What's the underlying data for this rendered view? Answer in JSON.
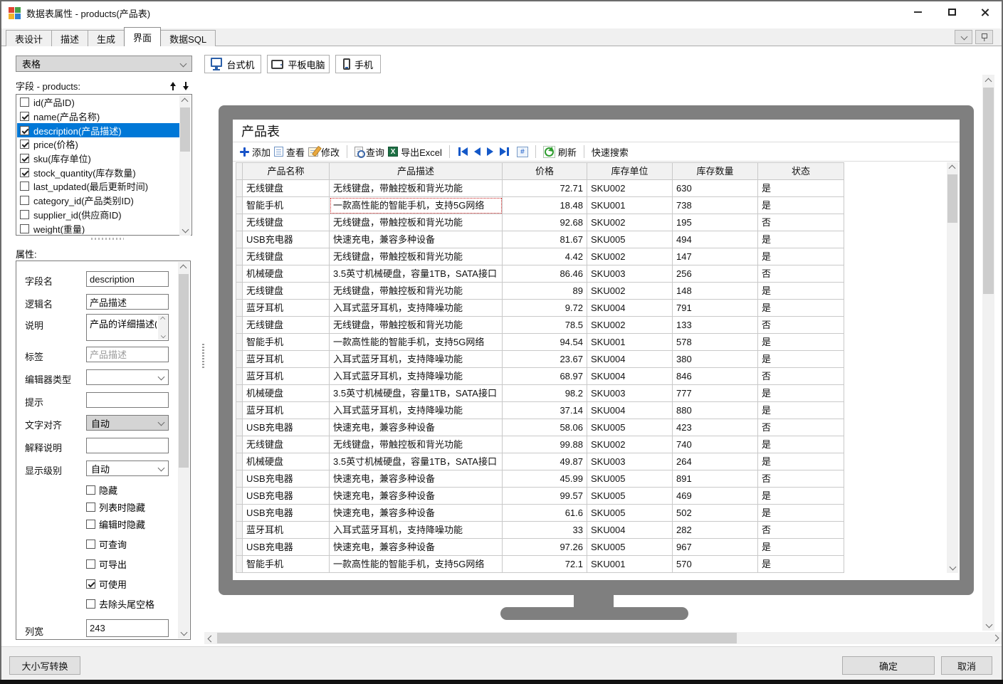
{
  "window": {
    "title": "数据表属性 - products(产品表)"
  },
  "tabs": [
    {
      "key": "design",
      "label": "表设计",
      "active": false
    },
    {
      "key": "describe",
      "label": "描述",
      "active": false
    },
    {
      "key": "generate",
      "label": "生成",
      "active": false
    },
    {
      "key": "ui",
      "label": "界面",
      "active": true
    },
    {
      "key": "sql",
      "label": "数据SQL",
      "active": false
    }
  ],
  "left": {
    "view_selector": "表格",
    "fields_label": "字段 - products:",
    "fields": [
      {
        "label": "id(产品ID)",
        "checked": false,
        "selected": false
      },
      {
        "label": "name(产品名称)",
        "checked": true,
        "selected": false
      },
      {
        "label": "description(产品描述)",
        "checked": true,
        "selected": true
      },
      {
        "label": "price(价格)",
        "checked": true,
        "selected": false
      },
      {
        "label": "sku(库存单位)",
        "checked": true,
        "selected": false
      },
      {
        "label": "stock_quantity(库存数量)",
        "checked": true,
        "selected": false
      },
      {
        "label": "last_updated(最后更新时间)",
        "checked": false,
        "selected": false
      },
      {
        "label": "category_id(产品类别ID)",
        "checked": false,
        "selected": false
      },
      {
        "label": "supplier_id(供应商ID)",
        "checked": false,
        "selected": false
      },
      {
        "label": "weight(重量)",
        "checked": false,
        "selected": false
      }
    ],
    "properties": {
      "label": "属性:",
      "field_name_label": "字段名",
      "field_name_value": "description",
      "logic_name_label": "逻辑名",
      "logic_name_value": "产品描述",
      "desc_label": "说明",
      "desc_value": "产品的详细描述(",
      "tag_label": "标签",
      "tag_placeholder": "产品描述",
      "editor_label": "编辑器类型",
      "editor_value": "",
      "hint_label": "提示",
      "hint_value": "",
      "align_label": "文字对齐",
      "align_value": "自动",
      "explain_label": "解释说明",
      "explain_value": "",
      "level_label": "显示级别",
      "level_value": "自动",
      "checkboxes": [
        {
          "label": "隐藏",
          "checked": false
        },
        {
          "label": "列表时隐藏",
          "checked": false
        },
        {
          "label": "编辑时隐藏",
          "checked": false
        },
        {
          "label": "可查询",
          "checked": false
        },
        {
          "label": "可导出",
          "checked": false
        },
        {
          "label": "可使用",
          "checked": true
        },
        {
          "label": "去除头尾空格",
          "checked": false
        }
      ],
      "colwidth_label": "列宽",
      "colwidth_value": "243"
    }
  },
  "preview": {
    "device_buttons": [
      {
        "key": "desktop",
        "label": "台式机"
      },
      {
        "key": "tablet",
        "label": "平板电脑"
      },
      {
        "key": "phone",
        "label": "手机"
      }
    ],
    "page_title": "产品表",
    "toolbar": {
      "add": "添加",
      "view": "查看",
      "edit": "修改",
      "query": "查询",
      "export": "导出Excel",
      "refresh": "刷新",
      "quick_search": "快速搜索"
    },
    "table": {
      "columns": [
        "产品名称",
        "产品描述",
        "价格",
        "库存单位",
        "库存数量",
        "状态"
      ],
      "selected_cell": {
        "row": 1,
        "col": 1
      },
      "rows": [
        [
          "无线键盘",
          "无线键盘，带触控板和背光功能",
          "72.71",
          "SKU002",
          "630",
          "是"
        ],
        [
          "智能手机",
          "一款高性能的智能手机，支持5G网络",
          "18.48",
          "SKU001",
          "738",
          "是"
        ],
        [
          "无线键盘",
          "无线键盘，带触控板和背光功能",
          "92.68",
          "SKU002",
          "195",
          "否"
        ],
        [
          "USB充电器",
          "快速充电，兼容多种设备",
          "81.67",
          "SKU005",
          "494",
          "是"
        ],
        [
          "无线键盘",
          "无线键盘，带触控板和背光功能",
          "4.42",
          "SKU002",
          "147",
          "是"
        ],
        [
          "机械硬盘",
          "3.5英寸机械硬盘，容量1TB，SATA接口",
          "86.46",
          "SKU003",
          "256",
          "否"
        ],
        [
          "无线键盘",
          "无线键盘，带触控板和背光功能",
          "89",
          "SKU002",
          "148",
          "是"
        ],
        [
          "蓝牙耳机",
          "入耳式蓝牙耳机，支持降噪功能",
          "9.72",
          "SKU004",
          "791",
          "是"
        ],
        [
          "无线键盘",
          "无线键盘，带触控板和背光功能",
          "78.5",
          "SKU002",
          "133",
          "否"
        ],
        [
          "智能手机",
          "一款高性能的智能手机，支持5G网络",
          "94.54",
          "SKU001",
          "578",
          "是"
        ],
        [
          "蓝牙耳机",
          "入耳式蓝牙耳机，支持降噪功能",
          "23.67",
          "SKU004",
          "380",
          "是"
        ],
        [
          "蓝牙耳机",
          "入耳式蓝牙耳机，支持降噪功能",
          "68.97",
          "SKU004",
          "846",
          "否"
        ],
        [
          "机械硬盘",
          "3.5英寸机械硬盘，容量1TB，SATA接口",
          "98.2",
          "SKU003",
          "777",
          "是"
        ],
        [
          "蓝牙耳机",
          "入耳式蓝牙耳机，支持降噪功能",
          "37.14",
          "SKU004",
          "880",
          "是"
        ],
        [
          "USB充电器",
          "快速充电，兼容多种设备",
          "58.06",
          "SKU005",
          "423",
          "否"
        ],
        [
          "无线键盘",
          "无线键盘，带触控板和背光功能",
          "99.88",
          "SKU002",
          "740",
          "是"
        ],
        [
          "机械硬盘",
          "3.5英寸机械硬盘，容量1TB，SATA接口",
          "49.87",
          "SKU003",
          "264",
          "是"
        ],
        [
          "USB充电器",
          "快速充电，兼容多种设备",
          "45.99",
          "SKU005",
          "891",
          "否"
        ],
        [
          "USB充电器",
          "快速充电，兼容多种设备",
          "99.57",
          "SKU005",
          "469",
          "是"
        ],
        [
          "USB充电器",
          "快速充电，兼容多种设备",
          "61.6",
          "SKU005",
          "502",
          "是"
        ],
        [
          "蓝牙耳机",
          "入耳式蓝牙耳机，支持降噪功能",
          "33",
          "SKU004",
          "282",
          "否"
        ],
        [
          "USB充电器",
          "快速充电，兼容多种设备",
          "97.26",
          "SKU005",
          "967",
          "是"
        ],
        [
          "智能手机",
          "一款高性能的智能手机，支持5G网络",
          "72.1",
          "SKU001",
          "570",
          "是"
        ]
      ]
    }
  },
  "footer": {
    "case_convert": "大小写转换",
    "ok": "确定",
    "cancel": "取消"
  }
}
